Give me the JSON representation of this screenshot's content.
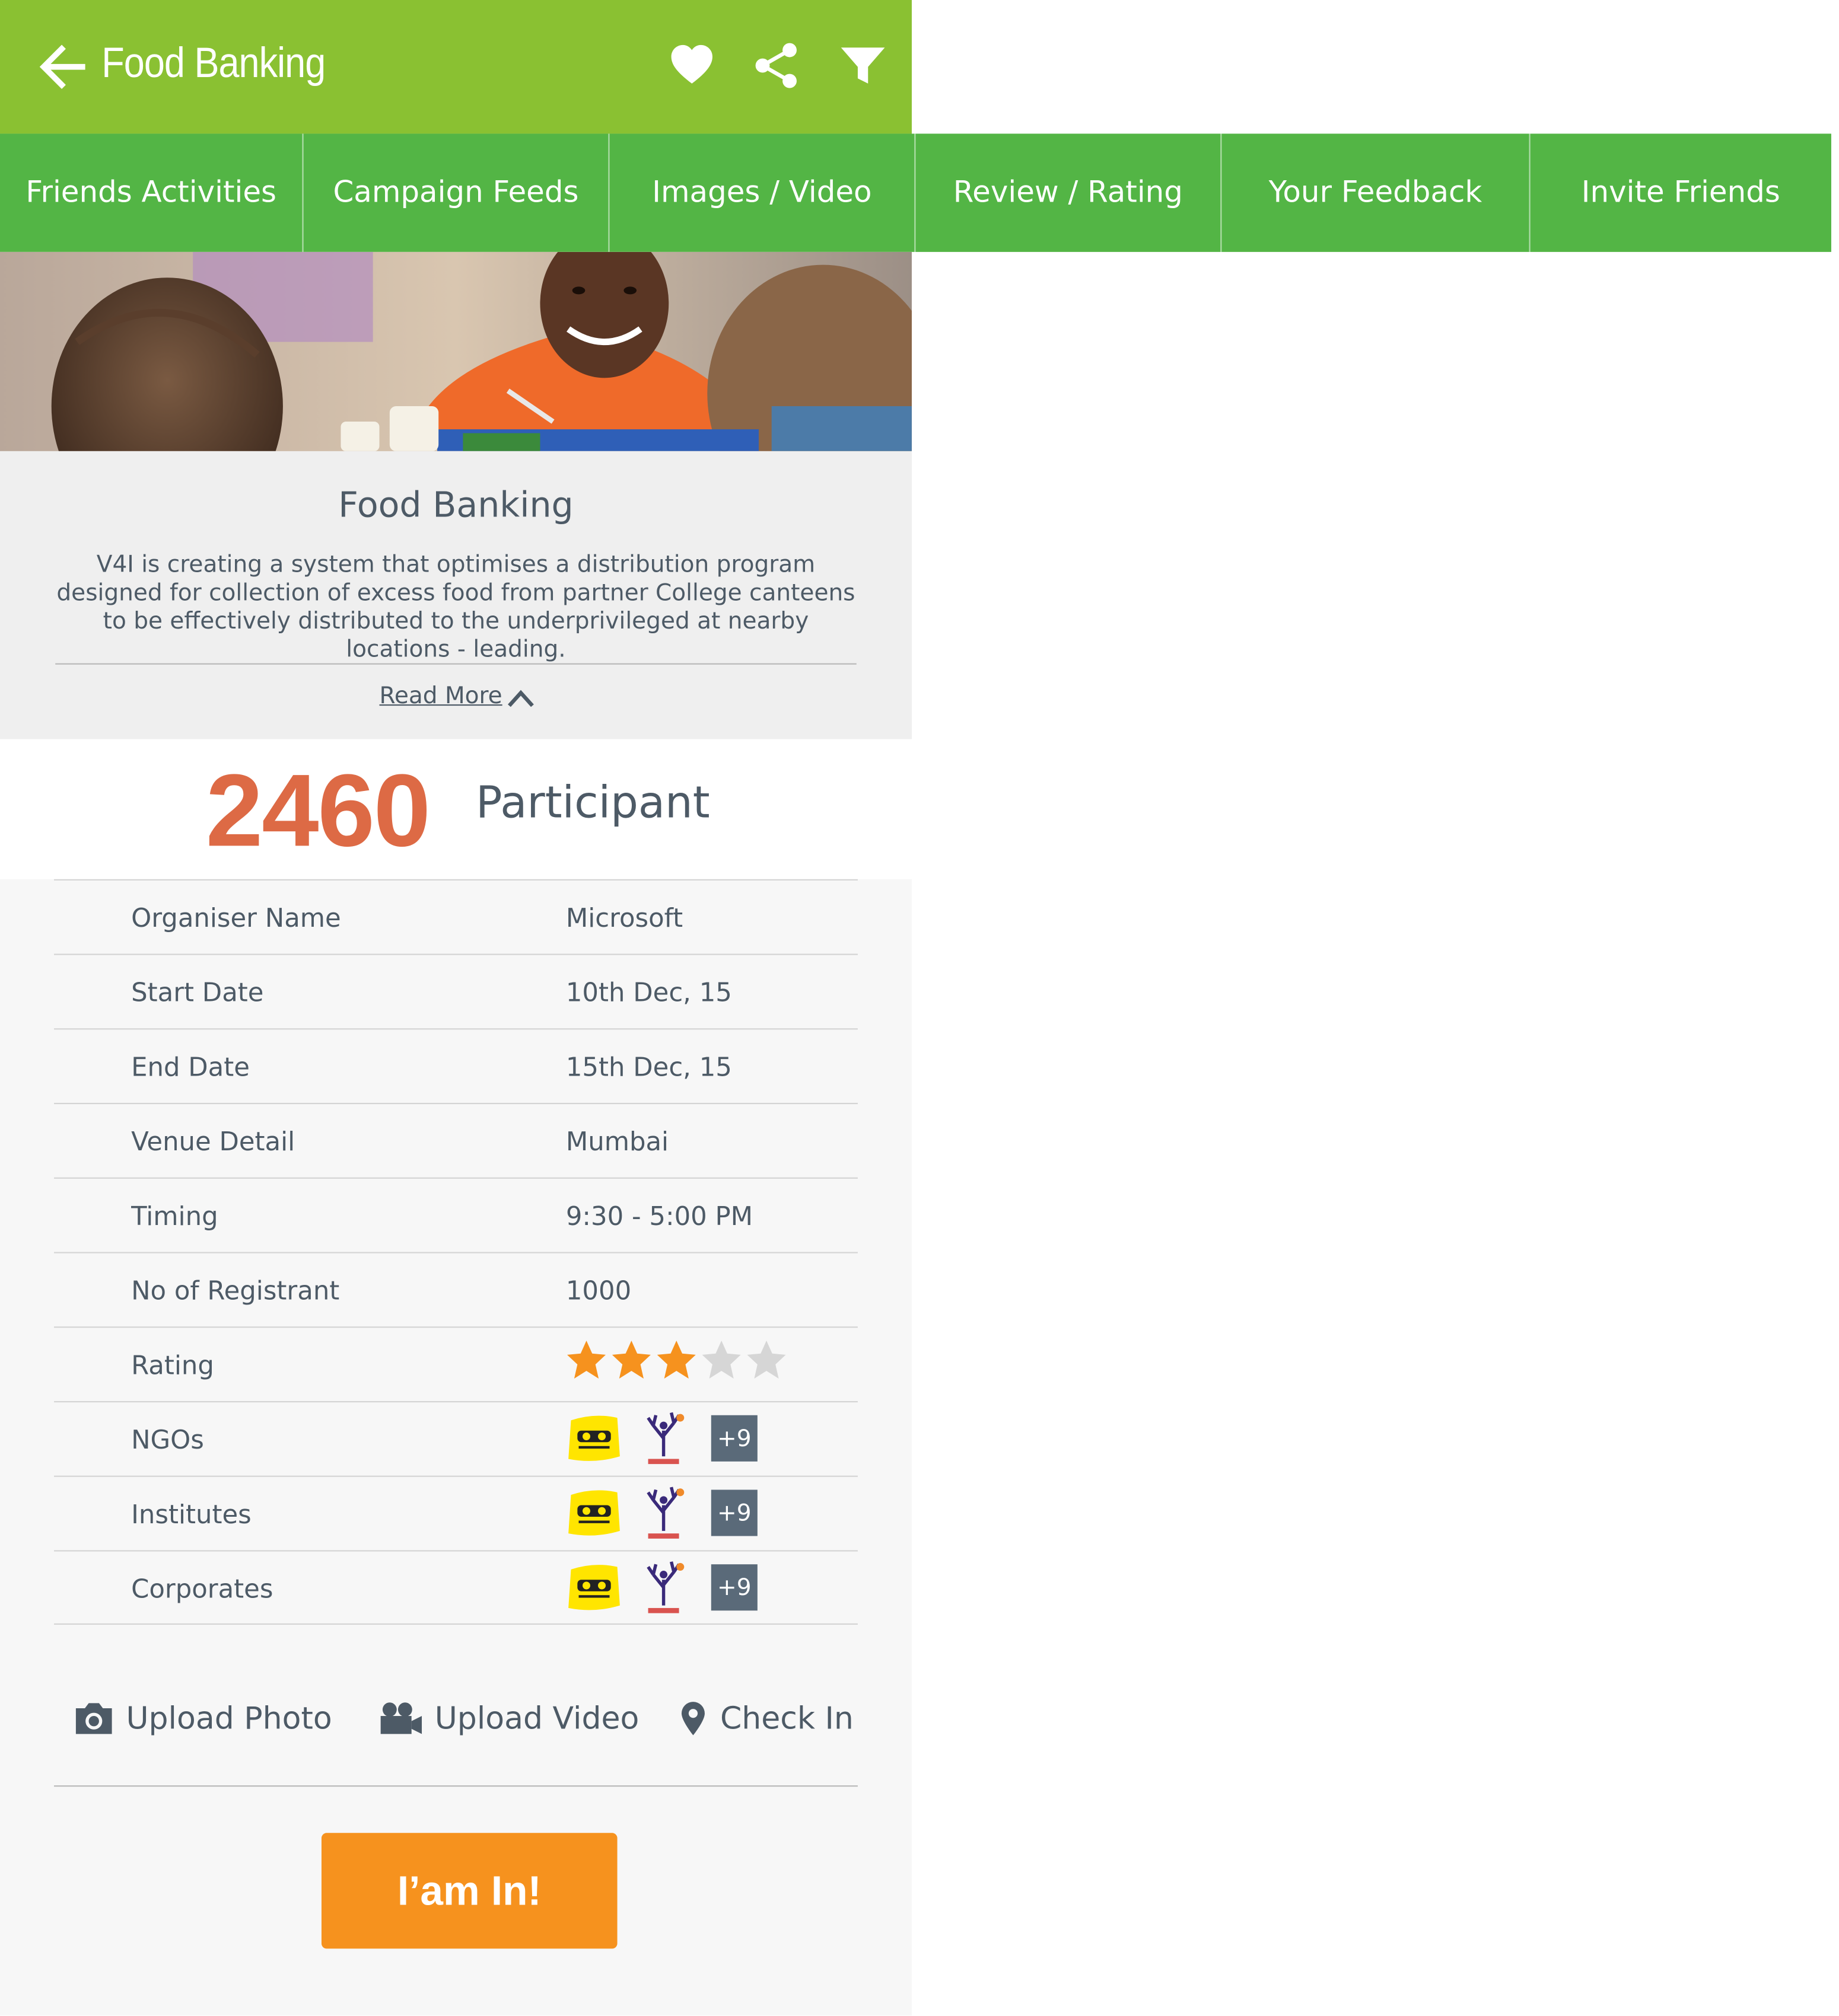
{
  "header": {
    "title": "Food Banking",
    "back_icon": "arrow-left-icon",
    "actions": [
      "heart-icon",
      "share-icon",
      "filter-icon"
    ],
    "color": "#8ac132"
  },
  "tabs": [
    {
      "label": "Friends Activities"
    },
    {
      "label": "Campaign Feeds"
    },
    {
      "label": "Images / Video"
    },
    {
      "label": "Review / Rating"
    },
    {
      "label": "Your Feedback"
    },
    {
      "label": "Invite Friends"
    }
  ],
  "campaign": {
    "title": "Food Banking",
    "description": "V4I is creating a system that optimises a distribution program designed for collection of excess food from partner College canteens to be effectively distributed to the underprivileged at nearby locations - leading.",
    "read_more": "Read More",
    "participants": "2460",
    "participants_label": "Participant"
  },
  "details": {
    "organiser": {
      "label": "Organiser Name",
      "value": "Microsoft"
    },
    "start": {
      "label": "Start Date",
      "value": "10th Dec, 15"
    },
    "end": {
      "label": "End Date",
      "value": "15th Dec, 15"
    },
    "venue": {
      "label": "Venue Detail",
      "value": "Mumbai"
    },
    "timing": {
      "label": "Timing",
      "value": "9:30 - 5:00 PM"
    },
    "registrants": {
      "label": "No of Registrant",
      "value": "1000"
    },
    "rating": {
      "label": "Rating",
      "value": 3,
      "max": 5
    },
    "ngos": {
      "label": "NGOs",
      "more": "+9"
    },
    "institutes": {
      "label": "Institutes",
      "more": "+9"
    },
    "corporates": {
      "label": "Corporates",
      "more": "+9"
    }
  },
  "actions": {
    "upload_photo": "Upload Photo",
    "upload_video": "Upload Video",
    "check_in": "Check In"
  },
  "cta": "I’am In!",
  "colors": {
    "tab_bar": "#53b545",
    "accent_orange": "#f6921e",
    "participant_number": "#dd6a45",
    "text": "#4d5a66"
  }
}
